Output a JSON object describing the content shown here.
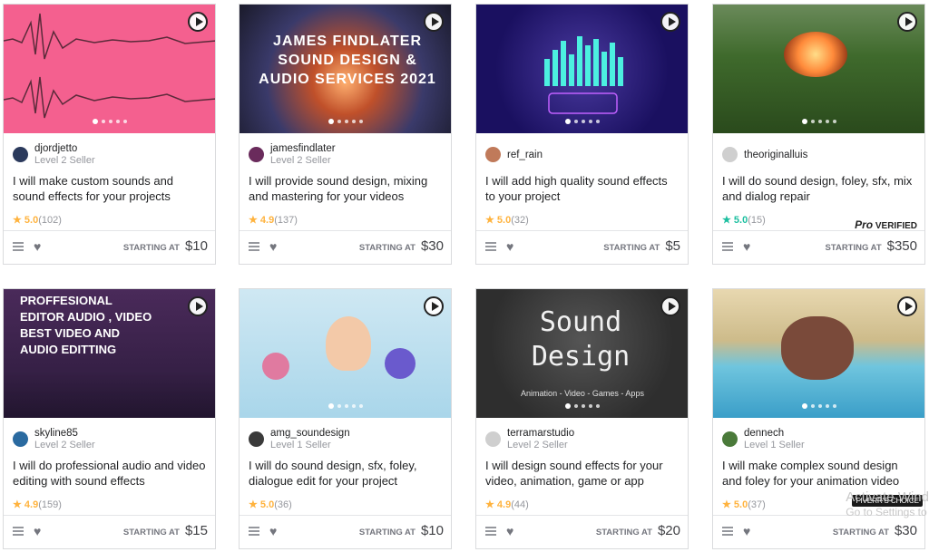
{
  "gigs": [
    {
      "seller": "djordjetto",
      "level": "Level 2 Seller",
      "title": "I will make custom sounds and sound effects for your projects",
      "rating": "5.0",
      "count": "(102)",
      "start_label": "STARTING AT",
      "price": "$10",
      "thumb_bg": "#f4608f"
    },
    {
      "seller": "jamesfindlater",
      "level": "Level 2 Seller",
      "title": "I will provide sound design, mixing and mastering for your videos",
      "rating": "4.9",
      "count": "(137)",
      "start_label": "STARTING AT",
      "price": "$30",
      "thumb_text": "JAMES FINDLATER SOUND DESIGN & AUDIO SERVICES 2021",
      "thumb_bg": "#2a2a3a"
    },
    {
      "seller": "ref_rain",
      "level": "",
      "title": "I will add high quality sound effects to your project",
      "rating": "5.0",
      "count": "(32)",
      "start_label": "STARTING AT",
      "price": "$5",
      "thumb_bg": "#1a1060"
    },
    {
      "seller": "theoriginalluis",
      "level": "",
      "title": "I will do sound design, foley, sfx, mix and dialog repair",
      "rating": "5.0",
      "count": "(15)",
      "start_label": "STARTING AT",
      "price": "$350",
      "pro_label": "Pro",
      "pro_verified": "VERIFIED",
      "thumb_bg": "#3f6a2c"
    },
    {
      "seller": "skyline85",
      "level": "Level 2 Seller",
      "title": "I will do professional audio and video editing with sound effects",
      "rating": "4.9",
      "count": "(159)",
      "start_label": "STARTING AT",
      "price": "$15",
      "thumb_text": "PROFFESIONAL EDITOR AUDIO , VIDEO BEST VIDEO AND AUDIO EDITTING",
      "thumb_bg": "#3a1c4a"
    },
    {
      "seller": "amg_soundesign",
      "level": "Level 1 Seller",
      "title": "I will do sound design, sfx, foley, dialogue edit for your project",
      "rating": "5.0",
      "count": "(36)",
      "start_label": "STARTING AT",
      "price": "$10",
      "thumb_bg": "#bfe0ef"
    },
    {
      "seller": "terramarstudio",
      "level": "Level 2 Seller",
      "title": "I will design sound effects for your video, animation, game or app",
      "rating": "4.9",
      "count": "(44)",
      "start_label": "STARTING AT",
      "price": "$20",
      "thumb_text": "Sound Design",
      "thumb_sub": "Animation - Video - Games - Apps",
      "thumb_bg": "#2e2e2e"
    },
    {
      "seller": "dennech",
      "level": "Level 1 Seller",
      "title": "I will make complex sound design and foley for your animation video",
      "rating": "5.0",
      "count": "(37)",
      "start_label": "STARTING AT",
      "price": "$30",
      "badge": "FIVERR'S CHOICE",
      "thumb_bg": "#6fc5de"
    }
  ],
  "watermark": {
    "line1": "Activate Wind",
    "line2": "Go to Settings to"
  }
}
